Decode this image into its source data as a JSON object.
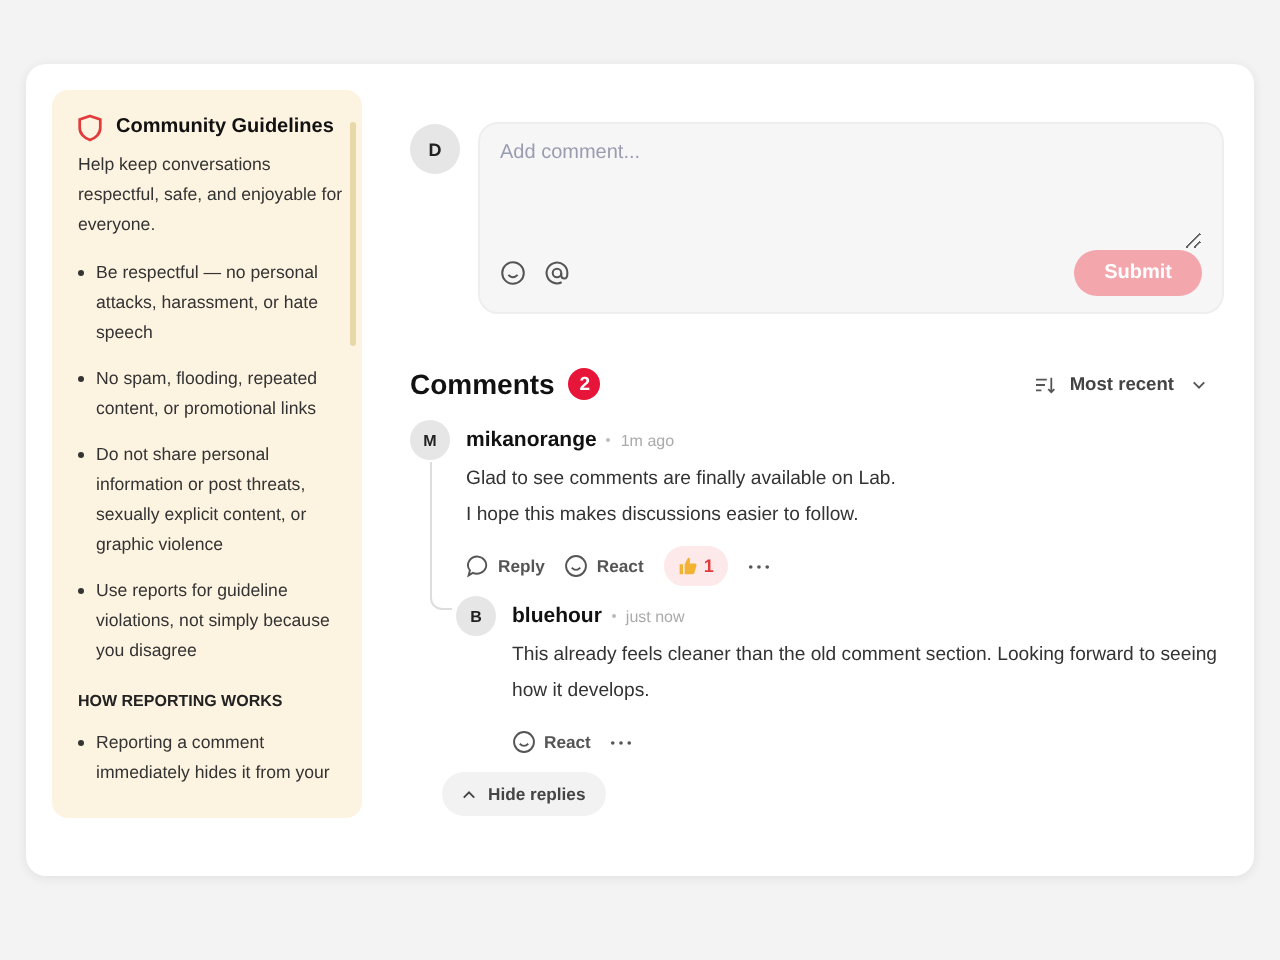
{
  "guidelines": {
    "title": "Community Guidelines",
    "intro": "Help keep conversations respectful, safe, and enjoyable for everyone.",
    "rules": [
      "Be respectful — no personal attacks, harassment, or hate speech",
      "No spam, flooding, repeated content, or promotional links",
      "Do not share personal information or post threats, sexually explicit content, or graphic violence",
      "Use reports for guideline violations, not simply because you disagree"
    ],
    "reporting_heading": "HOW REPORTING WORKS",
    "reporting": [
      "Reporting a comment immediately hides it from your"
    ]
  },
  "composer": {
    "avatar": "D",
    "placeholder": "Add comment...",
    "submit": {
      "label": "Submit",
      "disabled": true
    }
  },
  "comments_header": {
    "title": "Comments",
    "count": "2",
    "sort": "Most recent"
  },
  "comments": [
    {
      "avatar": "M",
      "author": "mikanorange",
      "time": "1m ago",
      "lines": [
        "Glad to see comments are finally available on Lab.",
        "I hope this makes discussions easier to follow."
      ],
      "reply_label": "Reply",
      "react_label": "React",
      "reactions": [
        {
          "count": "1",
          "reacted": true
        }
      ],
      "replies": [
        {
          "avatar": "B",
          "author": "bluehour",
          "time": "just now",
          "lines": [
            "This already feels cleaner than the old comment section. Looking forward to seeing how it develops."
          ],
          "react_label": "React"
        }
      ]
    }
  ],
  "hide_replies": "Hide replies"
}
